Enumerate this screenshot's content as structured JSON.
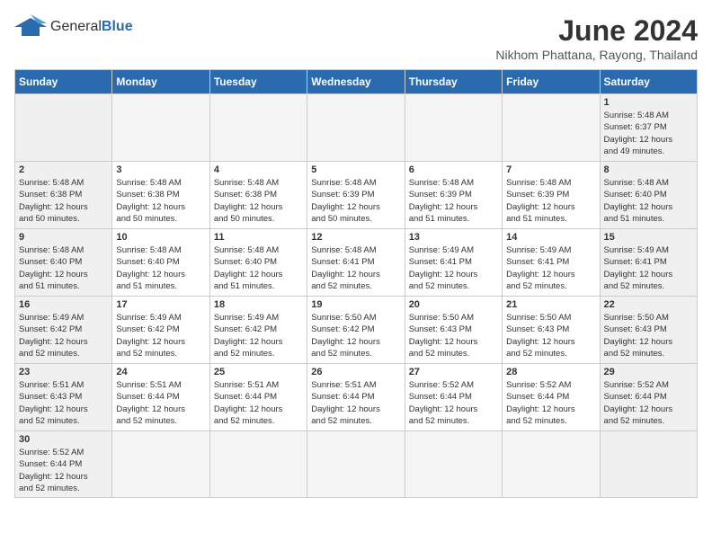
{
  "header": {
    "logo_general": "General",
    "logo_blue": "Blue",
    "month_title": "June 2024",
    "subtitle": "Nikhom Phattana, Rayong, Thailand"
  },
  "weekdays": [
    "Sunday",
    "Monday",
    "Tuesday",
    "Wednesday",
    "Thursday",
    "Friday",
    "Saturday"
  ],
  "weeks": [
    [
      {
        "day": "",
        "info": ""
      },
      {
        "day": "",
        "info": ""
      },
      {
        "day": "",
        "info": ""
      },
      {
        "day": "",
        "info": ""
      },
      {
        "day": "",
        "info": ""
      },
      {
        "day": "",
        "info": ""
      },
      {
        "day": "1",
        "info": "Sunrise: 5:48 AM\nSunset: 6:37 PM\nDaylight: 12 hours\nand 49 minutes."
      }
    ],
    [
      {
        "day": "2",
        "info": "Sunrise: 5:48 AM\nSunset: 6:38 PM\nDaylight: 12 hours\nand 50 minutes."
      },
      {
        "day": "3",
        "info": "Sunrise: 5:48 AM\nSunset: 6:38 PM\nDaylight: 12 hours\nand 50 minutes."
      },
      {
        "day": "4",
        "info": "Sunrise: 5:48 AM\nSunset: 6:38 PM\nDaylight: 12 hours\nand 50 minutes."
      },
      {
        "day": "5",
        "info": "Sunrise: 5:48 AM\nSunset: 6:39 PM\nDaylight: 12 hours\nand 50 minutes."
      },
      {
        "day": "6",
        "info": "Sunrise: 5:48 AM\nSunset: 6:39 PM\nDaylight: 12 hours\nand 51 minutes."
      },
      {
        "day": "7",
        "info": "Sunrise: 5:48 AM\nSunset: 6:39 PM\nDaylight: 12 hours\nand 51 minutes."
      },
      {
        "day": "8",
        "info": "Sunrise: 5:48 AM\nSunset: 6:40 PM\nDaylight: 12 hours\nand 51 minutes."
      }
    ],
    [
      {
        "day": "9",
        "info": "Sunrise: 5:48 AM\nSunset: 6:40 PM\nDaylight: 12 hours\nand 51 minutes."
      },
      {
        "day": "10",
        "info": "Sunrise: 5:48 AM\nSunset: 6:40 PM\nDaylight: 12 hours\nand 51 minutes."
      },
      {
        "day": "11",
        "info": "Sunrise: 5:48 AM\nSunset: 6:40 PM\nDaylight: 12 hours\nand 51 minutes."
      },
      {
        "day": "12",
        "info": "Sunrise: 5:48 AM\nSunset: 6:41 PM\nDaylight: 12 hours\nand 52 minutes."
      },
      {
        "day": "13",
        "info": "Sunrise: 5:49 AM\nSunset: 6:41 PM\nDaylight: 12 hours\nand 52 minutes."
      },
      {
        "day": "14",
        "info": "Sunrise: 5:49 AM\nSunset: 6:41 PM\nDaylight: 12 hours\nand 52 minutes."
      },
      {
        "day": "15",
        "info": "Sunrise: 5:49 AM\nSunset: 6:41 PM\nDaylight: 12 hours\nand 52 minutes."
      }
    ],
    [
      {
        "day": "16",
        "info": "Sunrise: 5:49 AM\nSunset: 6:42 PM\nDaylight: 12 hours\nand 52 minutes."
      },
      {
        "day": "17",
        "info": "Sunrise: 5:49 AM\nSunset: 6:42 PM\nDaylight: 12 hours\nand 52 minutes."
      },
      {
        "day": "18",
        "info": "Sunrise: 5:49 AM\nSunset: 6:42 PM\nDaylight: 12 hours\nand 52 minutes."
      },
      {
        "day": "19",
        "info": "Sunrise: 5:50 AM\nSunset: 6:42 PM\nDaylight: 12 hours\nand 52 minutes."
      },
      {
        "day": "20",
        "info": "Sunrise: 5:50 AM\nSunset: 6:43 PM\nDaylight: 12 hours\nand 52 minutes."
      },
      {
        "day": "21",
        "info": "Sunrise: 5:50 AM\nSunset: 6:43 PM\nDaylight: 12 hours\nand 52 minutes."
      },
      {
        "day": "22",
        "info": "Sunrise: 5:50 AM\nSunset: 6:43 PM\nDaylight: 12 hours\nand 52 minutes."
      }
    ],
    [
      {
        "day": "23",
        "info": "Sunrise: 5:51 AM\nSunset: 6:43 PM\nDaylight: 12 hours\nand 52 minutes."
      },
      {
        "day": "24",
        "info": "Sunrise: 5:51 AM\nSunset: 6:44 PM\nDaylight: 12 hours\nand 52 minutes."
      },
      {
        "day": "25",
        "info": "Sunrise: 5:51 AM\nSunset: 6:44 PM\nDaylight: 12 hours\nand 52 minutes."
      },
      {
        "day": "26",
        "info": "Sunrise: 5:51 AM\nSunset: 6:44 PM\nDaylight: 12 hours\nand 52 minutes."
      },
      {
        "day": "27",
        "info": "Sunrise: 5:52 AM\nSunset: 6:44 PM\nDaylight: 12 hours\nand 52 minutes."
      },
      {
        "day": "28",
        "info": "Sunrise: 5:52 AM\nSunset: 6:44 PM\nDaylight: 12 hours\nand 52 minutes."
      },
      {
        "day": "29",
        "info": "Sunrise: 5:52 AM\nSunset: 6:44 PM\nDaylight: 12 hours\nand 52 minutes."
      }
    ],
    [
      {
        "day": "30",
        "info": "Sunrise: 5:52 AM\nSunset: 6:44 PM\nDaylight: 12 hours\nand 52 minutes."
      },
      {
        "day": "",
        "info": ""
      },
      {
        "day": "",
        "info": ""
      },
      {
        "day": "",
        "info": ""
      },
      {
        "day": "",
        "info": ""
      },
      {
        "day": "",
        "info": ""
      },
      {
        "day": "",
        "info": ""
      }
    ]
  ]
}
